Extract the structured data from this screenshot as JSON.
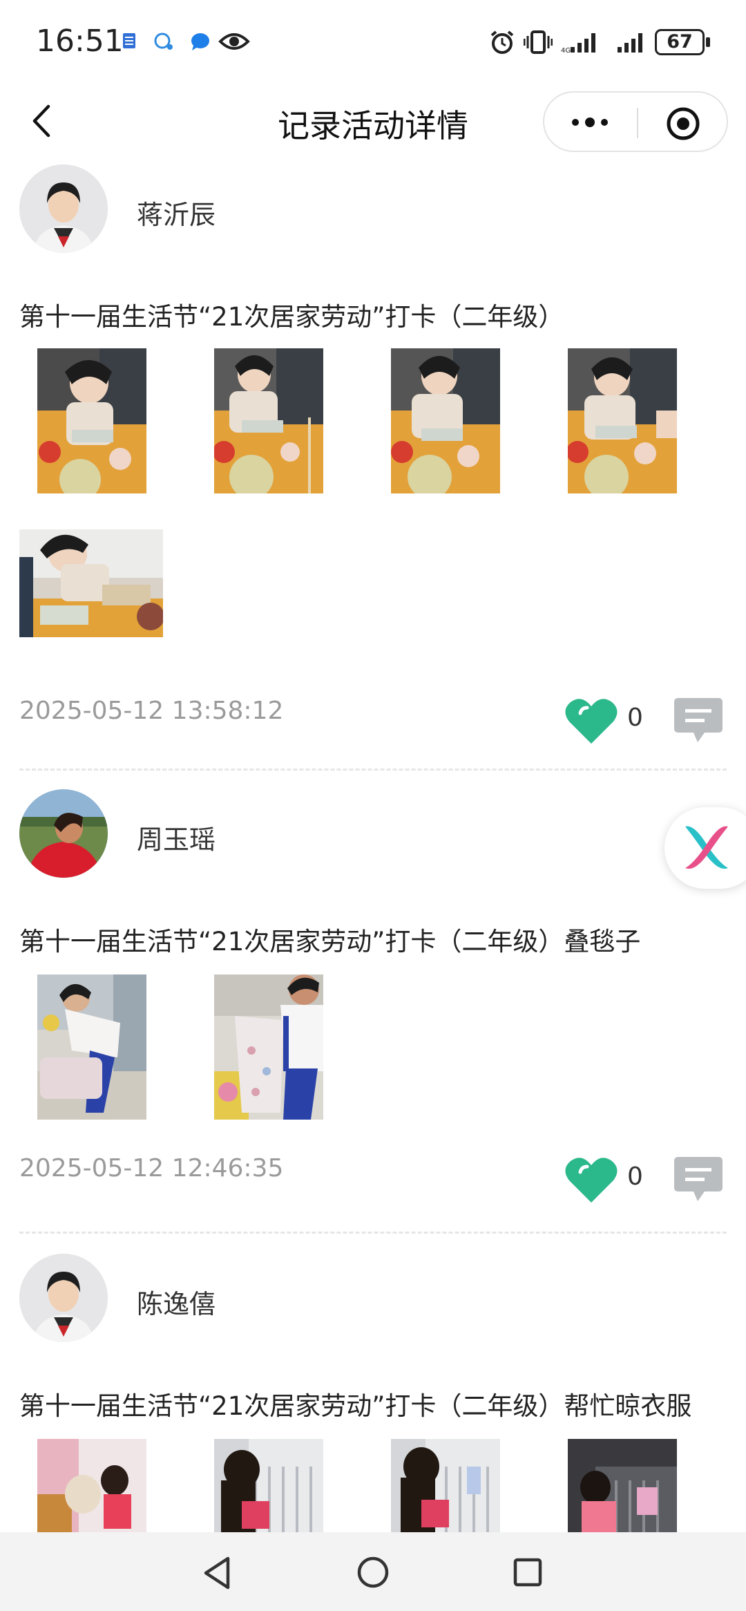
{
  "status_bar": {
    "time": "16:51",
    "battery": "67",
    "icons": [
      "app-notice-icon",
      "chat-bubble-icon",
      "message-icon",
      "eye-icon",
      "alarm-icon",
      "vibrate-icon",
      "signal-icon",
      "signal-icon",
      "battery-icon"
    ]
  },
  "nav": {
    "title": "记录活动详情",
    "back_icon": "chevron-left-icon",
    "more_icon": "more-dots-icon",
    "close_icon": "target-circle-icon"
  },
  "posts": [
    {
      "user": "蒋沂辰",
      "title": "第十一届生活节“21次居家劳动”打卡（二年级）",
      "timestamp": "2025-05-12 13:58:12",
      "likes": "0"
    },
    {
      "user": "周玉瑶",
      "title": "第十一届生活节“21次居家劳动”打卡（二年级）叠毯子",
      "timestamp": "2025-05-12 12:46:35",
      "likes": "0"
    },
    {
      "user": "陈逸僖",
      "title": "第十一届生活节“21次居家劳动”打卡（二年级）帮忙晾衣服"
    }
  ],
  "colors": {
    "heart": "#2bb88a",
    "comment": "#b9bdc0",
    "timestamp": "#9a9a9a"
  },
  "bottom_nav": [
    "back-triangle-icon",
    "home-circle-icon",
    "recents-square-icon"
  ]
}
